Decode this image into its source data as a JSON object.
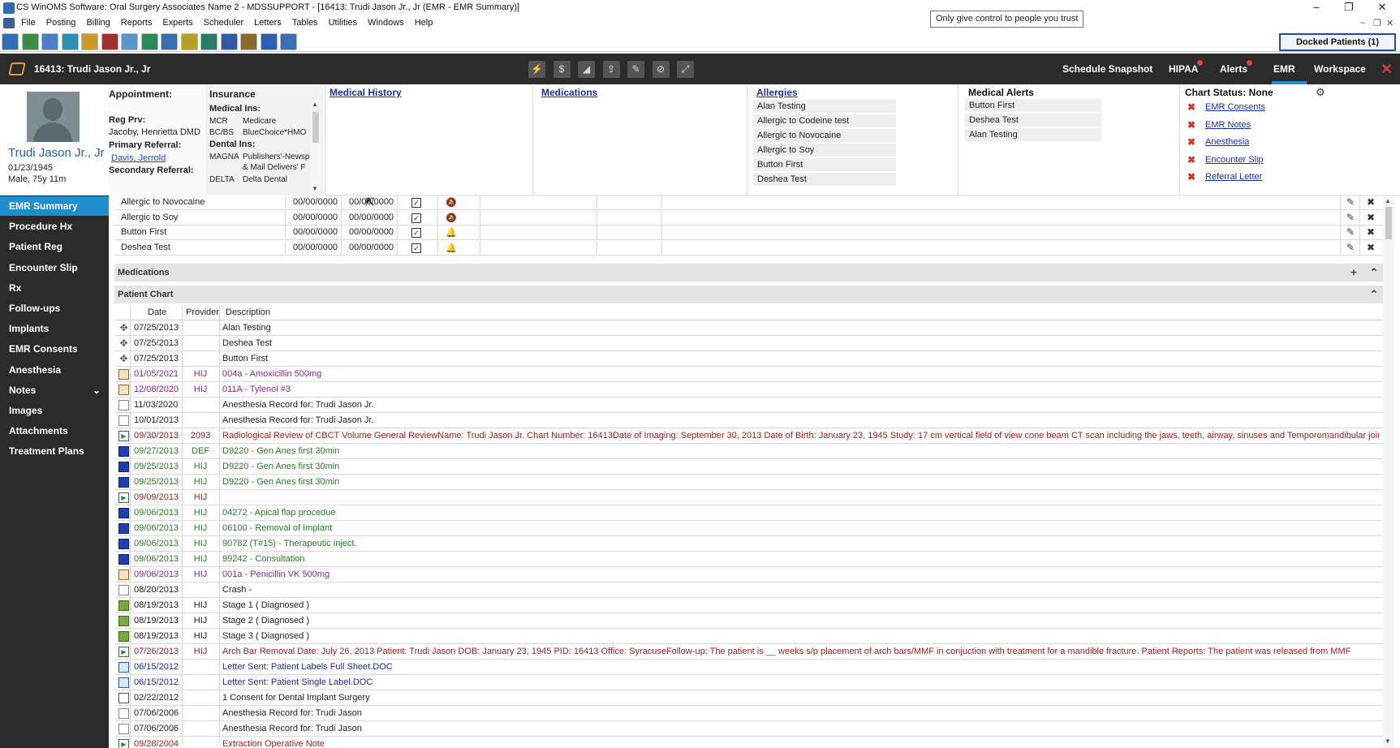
{
  "window": {
    "title": "CS WinOMS Software:  Oral Surgery Associates Name 2 - MDSSUPPORT - [16413: Trudi Jason Jr., Jr (EMR - EMR Summary)]",
    "tooltip": "Only give control to people you trust",
    "minimize": "–",
    "restore": "❐",
    "close": "✕",
    "mdi_min": "–",
    "mdi_restore": "❐",
    "mdi_close": "✕"
  },
  "menu": [
    "File",
    "Posting",
    "Billing",
    "Reports",
    "Experts",
    "Scheduler",
    "Letters",
    "Tables",
    "Utilities",
    "Windows",
    "Help"
  ],
  "toolbar": {
    "docked_label": "Docked Patients (1)",
    "buttons": [
      {
        "icon": "patient-info-icon",
        "color": "#2f6db5"
      },
      {
        "icon": "tree-icon",
        "color": "#3f8a4a"
      },
      {
        "icon": "search-doc-icon",
        "color": "#4a7fc2"
      },
      {
        "icon": "ledger-icon",
        "color": "#2f8cb5"
      },
      {
        "icon": "settings-icon",
        "color": "#c99a2a"
      },
      {
        "icon": "medical-icon",
        "color": "#a23030"
      },
      {
        "icon": "chart-icon",
        "color": "#5a96c8"
      },
      {
        "icon": "exit-icon",
        "color": "#2a8a5a"
      },
      {
        "icon": "calendar-icon",
        "color": "#3a6fb0"
      },
      {
        "icon": "report-icon",
        "color": "#b5a02a"
      },
      {
        "icon": "camera-icon",
        "color": "#2a7a6a"
      },
      {
        "icon": "windows-icon",
        "color": "#2f5aa8"
      },
      {
        "icon": "book-icon",
        "color": "#8a6a2a"
      },
      {
        "icon": "info-icon",
        "color": "#2f5fb0"
      },
      {
        "icon": "transfer-icon",
        "color": "#3a6fb0"
      }
    ]
  },
  "patient_bar": {
    "title": "16413: Trudi Jason Jr., Jr",
    "quick_actions": [
      "⚡",
      "$",
      "◢",
      "⇪",
      "✎",
      "⊘",
      "⤢"
    ],
    "nav": [
      "Schedule Snapshot",
      "HIPAA",
      "Alerts",
      "EMR",
      "Workspace"
    ],
    "close": "✕"
  },
  "patient": {
    "name": "Trudi Jason Jr., Jr",
    "dob": "01/23/1945",
    "age": "Male, 75y 11m"
  },
  "appointment": {
    "heading": "Appointment:",
    "reg_prv_label": "Reg Prv:",
    "reg_prv": "Jacoby, Henrietta DMD",
    "primary_referral_label": "Primary Referral:",
    "primary_referral": "Davis, Jerrold",
    "secondary_referral_label": "Secondary Referral:"
  },
  "insurance": {
    "heading": "Insurance",
    "medical_label": "Medical Ins:",
    "medical": [
      {
        "code": "MCR",
        "name": "Medicare"
      },
      {
        "code": "BC/BS",
        "name": "BlueChoice*HMO"
      }
    ],
    "dental_label": "Dental Ins:",
    "dental": [
      {
        "code": "MAGNA",
        "name": "Publishers'-Newsp"
      },
      {
        "code": "",
        "name": "& Mail Delivers' F"
      },
      {
        "code": "DELTA",
        "name": "Delta Dental"
      }
    ]
  },
  "sections": {
    "medical_history": "Medical History",
    "medications": "Medications",
    "allergies": "Allergies",
    "medical_alerts": "Medical Alerts",
    "chart_status": "Chart Status:  None"
  },
  "allergies_list": [
    "Alan Testing",
    "Allergic to Codeine test",
    "Allergic to Novocaine",
    "Allergic to Soy",
    "Button First",
    "Deshea Test"
  ],
  "medical_alerts_list": [
    "Button First",
    "Deshea Test",
    "Alan Testing"
  ],
  "chart_status_items": [
    "EMR Consents",
    "EMR Notes",
    "Anesthesia",
    "Encounter Slip",
    "Referral Letter"
  ],
  "sidebar": {
    "items": [
      "EMR Summary",
      "Procedure Hx",
      "Patient Reg",
      "Encounter Slip",
      "Rx",
      "Follow-ups",
      "Implants",
      "EMR Consents",
      "Anesthesia",
      "Notes",
      "Images",
      "Attachments",
      "Treatment Plans"
    ],
    "notes_chevron": "⌄"
  },
  "allergy_rows": [
    {
      "name": "Allergic to Novocaine",
      "date1": "00/00/0000",
      "date2": "00/00/0000",
      "bell": "off"
    },
    {
      "name": "Allergic to Soy",
      "date1": "00/00/0000",
      "date2": "00/00/0000",
      "bell": "off"
    },
    {
      "name": "Button First",
      "date1": "00/00/0000",
      "date2": "00/00/0000",
      "bell": "on"
    },
    {
      "name": "Deshea Test",
      "date1": "00/00/0000",
      "date2": "00/00/0000",
      "bell": "on"
    }
  ],
  "panels": {
    "medications": "Medications",
    "patient_chart": "Patient Chart"
  },
  "chart_columns": [
    "Date",
    "Provider",
    "Description"
  ],
  "chart_rows": [
    {
      "icon": "arrows-icon",
      "date": "07/25/2013",
      "provider": "",
      "desc": "Alan Testing",
      "color": "#222222"
    },
    {
      "icon": "arrows-icon",
      "date": "07/25/2013",
      "provider": "",
      "desc": "Deshea Test",
      "color": "#222222"
    },
    {
      "icon": "arrows-icon",
      "date": "07/25/2013",
      "provider": "",
      "desc": "Button First",
      "color": "#222222"
    },
    {
      "icon": "medication-icon",
      "date": "01/05/2021",
      "provider": "HIJ",
      "desc": "004a - Amoxicillin 500mg",
      "color": "#8a2a8a"
    },
    {
      "icon": "medication-icon",
      "date": "12/08/2020",
      "provider": "HIJ",
      "desc": "011A - Tylenol #3",
      "color": "#8a2a8a"
    },
    {
      "icon": "document-icon",
      "date": "11/03/2020",
      "provider": "",
      "desc": "Anesthesia Record for: Trudi Jason Jr.",
      "color": "#222222"
    },
    {
      "icon": "document-icon",
      "date": "10/01/2013",
      "provider": "",
      "desc": "Anesthesia Record for: Trudi Jason Jr.",
      "color": "#222222"
    },
    {
      "icon": "play-icon",
      "date": "09/30/2013",
      "provider": "2093",
      "desc": "Radiological Review of CBCT Volume General ReviewName:  Trudi Jason Jr.   Chart Number:  16413Date of Imaging:  September 30, 2013     Date of Birth: January 23, 1945 Study:   17 cm vertical field of view cone beam CT scan including the jaws, teeth, airway, sinuses and Temporomandibular joints",
      "color": "#a02020"
    },
    {
      "icon": "procedure-icon",
      "date": "09/27/2013",
      "provider": "DEF",
      "desc": "D9220 - Gen Anes first 30min",
      "color": "#2a7a2a"
    },
    {
      "icon": "procedure-icon",
      "date": "09/25/2013",
      "provider": "HIJ",
      "desc": "D9220 - Gen Anes first 30min",
      "color": "#2a7a2a"
    },
    {
      "icon": "procedure-icon",
      "date": "09/25/2013",
      "provider": "HIJ",
      "desc": "D9220 - Gen Anes first 30min",
      "color": "#2a7a2a"
    },
    {
      "icon": "play-icon",
      "date": "09/09/2013",
      "provider": "HIJ",
      "desc": "",
      "color": "#a02020"
    },
    {
      "icon": "procedure-icon",
      "date": "09/06/2013",
      "provider": "HIJ",
      "desc": "04272 - Apical flap procedue",
      "color": "#2a7a2a"
    },
    {
      "icon": "procedure-icon",
      "date": "09/06/2013",
      "provider": "HIJ",
      "desc": "06100 - Removal of Implant",
      "color": "#2a7a2a"
    },
    {
      "icon": "procedure-icon",
      "date": "09/06/2013",
      "provider": "HIJ",
      "desc": "90782 (T#15) - Therapeutic inject.",
      "color": "#2a7a2a"
    },
    {
      "icon": "procedure-icon",
      "date": "09/06/2013",
      "provider": "HIJ",
      "desc": "99242 - Consultation",
      "color": "#2a7a2a"
    },
    {
      "icon": "medication-icon",
      "date": "09/06/2013",
      "provider": "HIJ",
      "desc": "001a - Penicillin VK 500mg",
      "color": "#8a2a8a"
    },
    {
      "icon": "document-icon",
      "date": "08/20/2013",
      "provider": "",
      "desc": "Crash -",
      "color": "#222222"
    },
    {
      "icon": "diagnosis-icon",
      "date": "08/19/2013",
      "provider": "HIJ",
      "desc": "Stage 1 ( Diagnosed )",
      "color": "#222222"
    },
    {
      "icon": "diagnosis-icon",
      "date": "08/19/2013",
      "provider": "HIJ",
      "desc": "Stage 2 ( Diagnosed )",
      "color": "#222222"
    },
    {
      "icon": "diagnosis-icon",
      "date": "08/19/2013",
      "provider": "HIJ",
      "desc": "Stage 3 ( Diagnosed )",
      "color": "#222222"
    },
    {
      "icon": "play-icon",
      "date": "07/26/2013",
      "provider": "HIJ",
      "desc": "Arch Bar Removal  Date:  July 26, 2013 Patient:  Trudi  Jason DOB:  January 23, 1945    PID:  16413 Office:  SyracuseFollow-up: The patient is __ weeks s/p placement of arch bars/MMF in conjuction with treatment for a mandible fracture. Patient Reports:  The patient was released from MMF",
      "color": "#a02020"
    },
    {
      "icon": "letter-icon",
      "date": "06/15/2012",
      "provider": "",
      "desc": "Letter Sent: Patient Labels Full Sheet.DOC",
      "color": "#1a2a9a"
    },
    {
      "icon": "letter-icon",
      "date": "06/15/2012",
      "provider": "",
      "desc": "Letter Sent: Patient Single Label.DOC",
      "color": "#1a2a9a"
    },
    {
      "icon": "consent-icon",
      "date": "02/22/2012",
      "provider": "",
      "desc": "1 Consent for Dental Implant Surgery",
      "color": "#222222"
    },
    {
      "icon": "document-icon",
      "date": "07/06/2006",
      "provider": "",
      "desc": "Anesthesia Record for: Trudi Jason",
      "color": "#222222"
    },
    {
      "icon": "document-icon",
      "date": "07/06/2006",
      "provider": "",
      "desc": "Anesthesia Record for: Trudi Jason",
      "color": "#222222"
    },
    {
      "icon": "play-icon",
      "date": "09/28/2004",
      "provider": "",
      "desc": "Extraction Operative Note",
      "color": "#a02020"
    }
  ],
  "colors": {
    "accent": "#1d8fcf",
    "dark_bar": "#2b2b2b",
    "link": "#1a30a8",
    "alert_red": "#d9302a"
  }
}
